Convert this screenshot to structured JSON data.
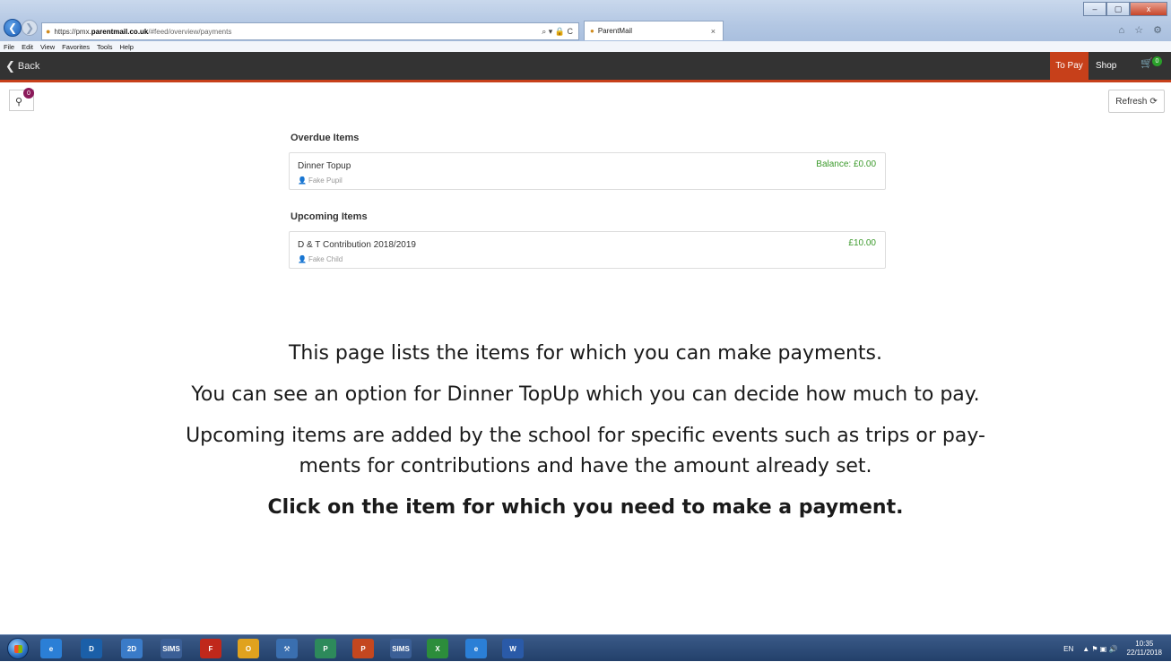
{
  "browser": {
    "url_prefix": "https://pmx.",
    "url_host": "parentmail.co.uk",
    "url_path": "/#feed/overview/payments",
    "address_tools": "⌕ ▾ 🔒 C",
    "tab_title": "ParentMail",
    "tab_close": "×",
    "window_buttons": [
      "–",
      "▢",
      "x"
    ],
    "chrome_icons": "⌂ ☆ ⚙",
    "menu": [
      "File",
      "Edit",
      "View",
      "Favorites",
      "Tools",
      "Help"
    ]
  },
  "header": {
    "back_label": "Back",
    "to_pay_label": "To Pay",
    "shop_label": "Shop",
    "cart_count": "0"
  },
  "toolbar": {
    "filter_count": "0",
    "refresh_label": "Refresh"
  },
  "sections": {
    "overdue": {
      "title": "Overdue Items",
      "items": [
        {
          "name": "Dinner Topup",
          "child": "Fake Pupil",
          "amount": "Balance: £0.00"
        }
      ]
    },
    "upcoming": {
      "title": "Upcoming Items",
      "items": [
        {
          "name": "D & T Contribution 2018/2019",
          "child": "Fake Child",
          "amount": "£10.00"
        }
      ]
    }
  },
  "instructions": {
    "line1": "This page lists the items for which you can make payments.",
    "line2": "You can see an option for Dinner TopUp which you can decide how much to pay.",
    "line3a": "Upcoming items are added by the school for specific events such as trips or pay-",
    "line3b": "ments for contributions and have the amount already set.",
    "line4": "Click on the item for which you need to make a payment."
  },
  "taskbar": {
    "apps": [
      {
        "icon": "internet-explorer-icon",
        "label": "e",
        "color": "#2b7fd6"
      },
      {
        "icon": "app-d-icon",
        "label": "D",
        "color": "#1b5fa8"
      },
      {
        "icon": "2d-design-icon",
        "label": "2D",
        "color": "#3a7bc8"
      },
      {
        "icon": "sims-icon",
        "label": "SIMS",
        "color": "#3b5f96"
      },
      {
        "icon": "filezilla-icon",
        "label": "F",
        "color": "#c0281b"
      },
      {
        "icon": "outlook-icon",
        "label": "O",
        "color": "#e0a21e"
      },
      {
        "icon": "tool-icon",
        "label": "⚒",
        "color": "#3a6fb0"
      },
      {
        "icon": "publisher-icon",
        "label": "P",
        "color": "#2d8a5b"
      },
      {
        "icon": "powerpoint-icon",
        "label": "P",
        "color": "#c4471f"
      },
      {
        "icon": "sims-icon-2",
        "label": "SIMS",
        "color": "#3b5f96"
      },
      {
        "icon": "excel-icon",
        "label": "X",
        "color": "#2c8d3b"
      },
      {
        "icon": "ie-icon-2",
        "label": "e",
        "color": "#2b7fd6"
      },
      {
        "icon": "word-icon",
        "label": "W",
        "color": "#2a5aa8"
      }
    ],
    "lang": "EN",
    "time": "10:35",
    "date": "22/11/2018"
  }
}
